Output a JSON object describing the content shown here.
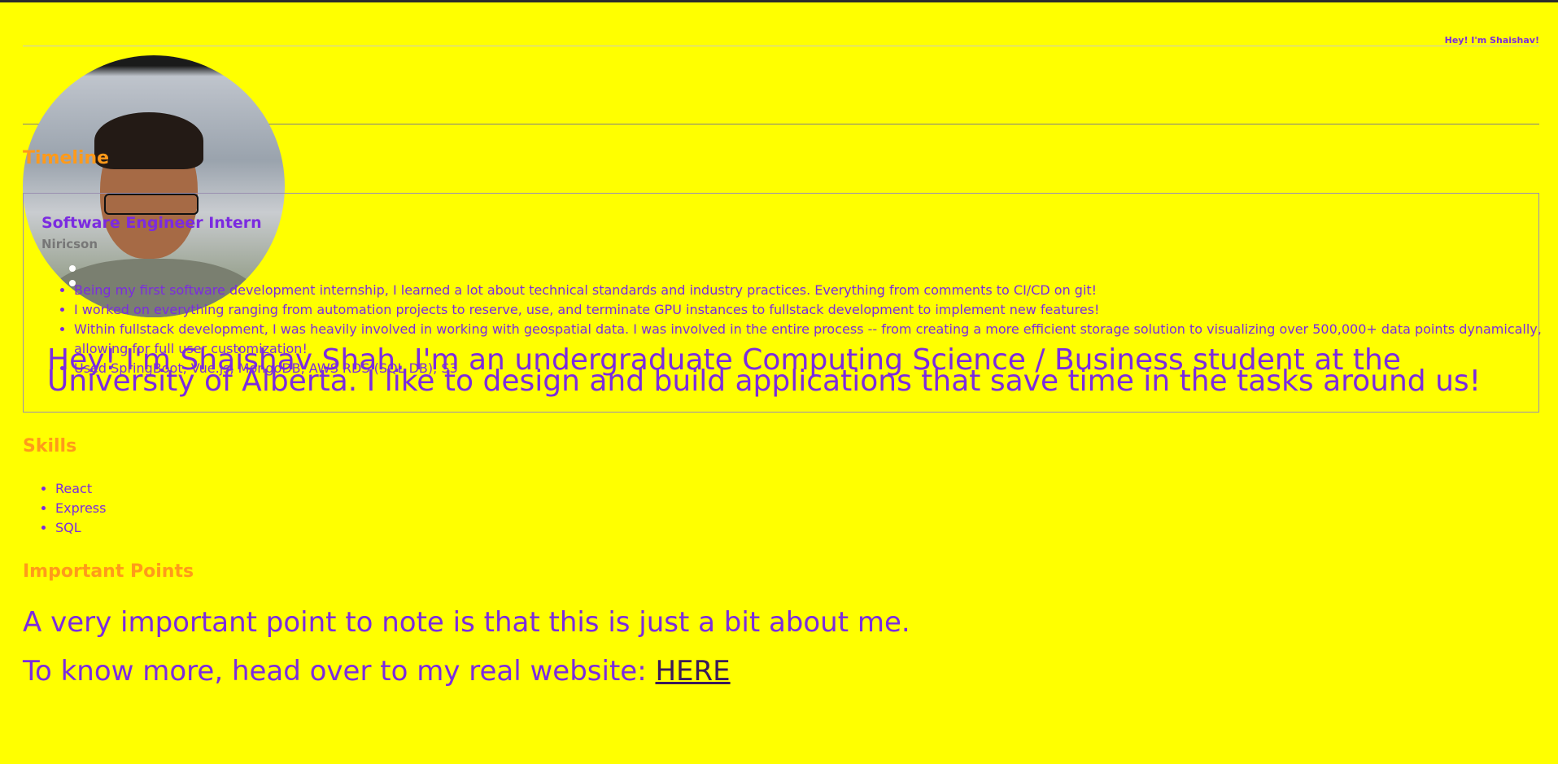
{
  "header": {
    "greeting": "Hey! I'm Shaishav!"
  },
  "timeline": {
    "title": "Timeline",
    "job": {
      "title": "Software Engineer Intern",
      "company": "Niricson",
      "points": [
        "Being my first software development internship, I learned a lot about technical standards and industry practices. Everything from comments to CI/CD on git!",
        "I worked on everything ranging from automation projects to reserve, use, and terminate GPU instances to fullstack development to implement new features!",
        "Within fullstack development, I was heavily involved in working with geospatial data. I was involved in the entire process -- from creating a more efficient storage solution to visualizing over 500,000+ data points dynamically, allowing for full user customization!",
        "Used SpringBoot, Vue.js, MongoDB, AWS RDS (SQL DB), S3"
      ]
    }
  },
  "hero": {
    "text": "Hey! I'm Shaishav Shah. I'm an undergraduate Computing Science / Business student at the University of Alberta. I like to design and build applications that save time in the tasks around us!"
  },
  "skills": {
    "title": "Skills",
    "items": [
      "React",
      "Express",
      "SQL"
    ]
  },
  "important": {
    "title": "Important Points",
    "line1": "A very important point to note is that this is just a bit about me.",
    "line2_prefix": "To know more, head over to my real website: ",
    "link_label": "HERE"
  }
}
